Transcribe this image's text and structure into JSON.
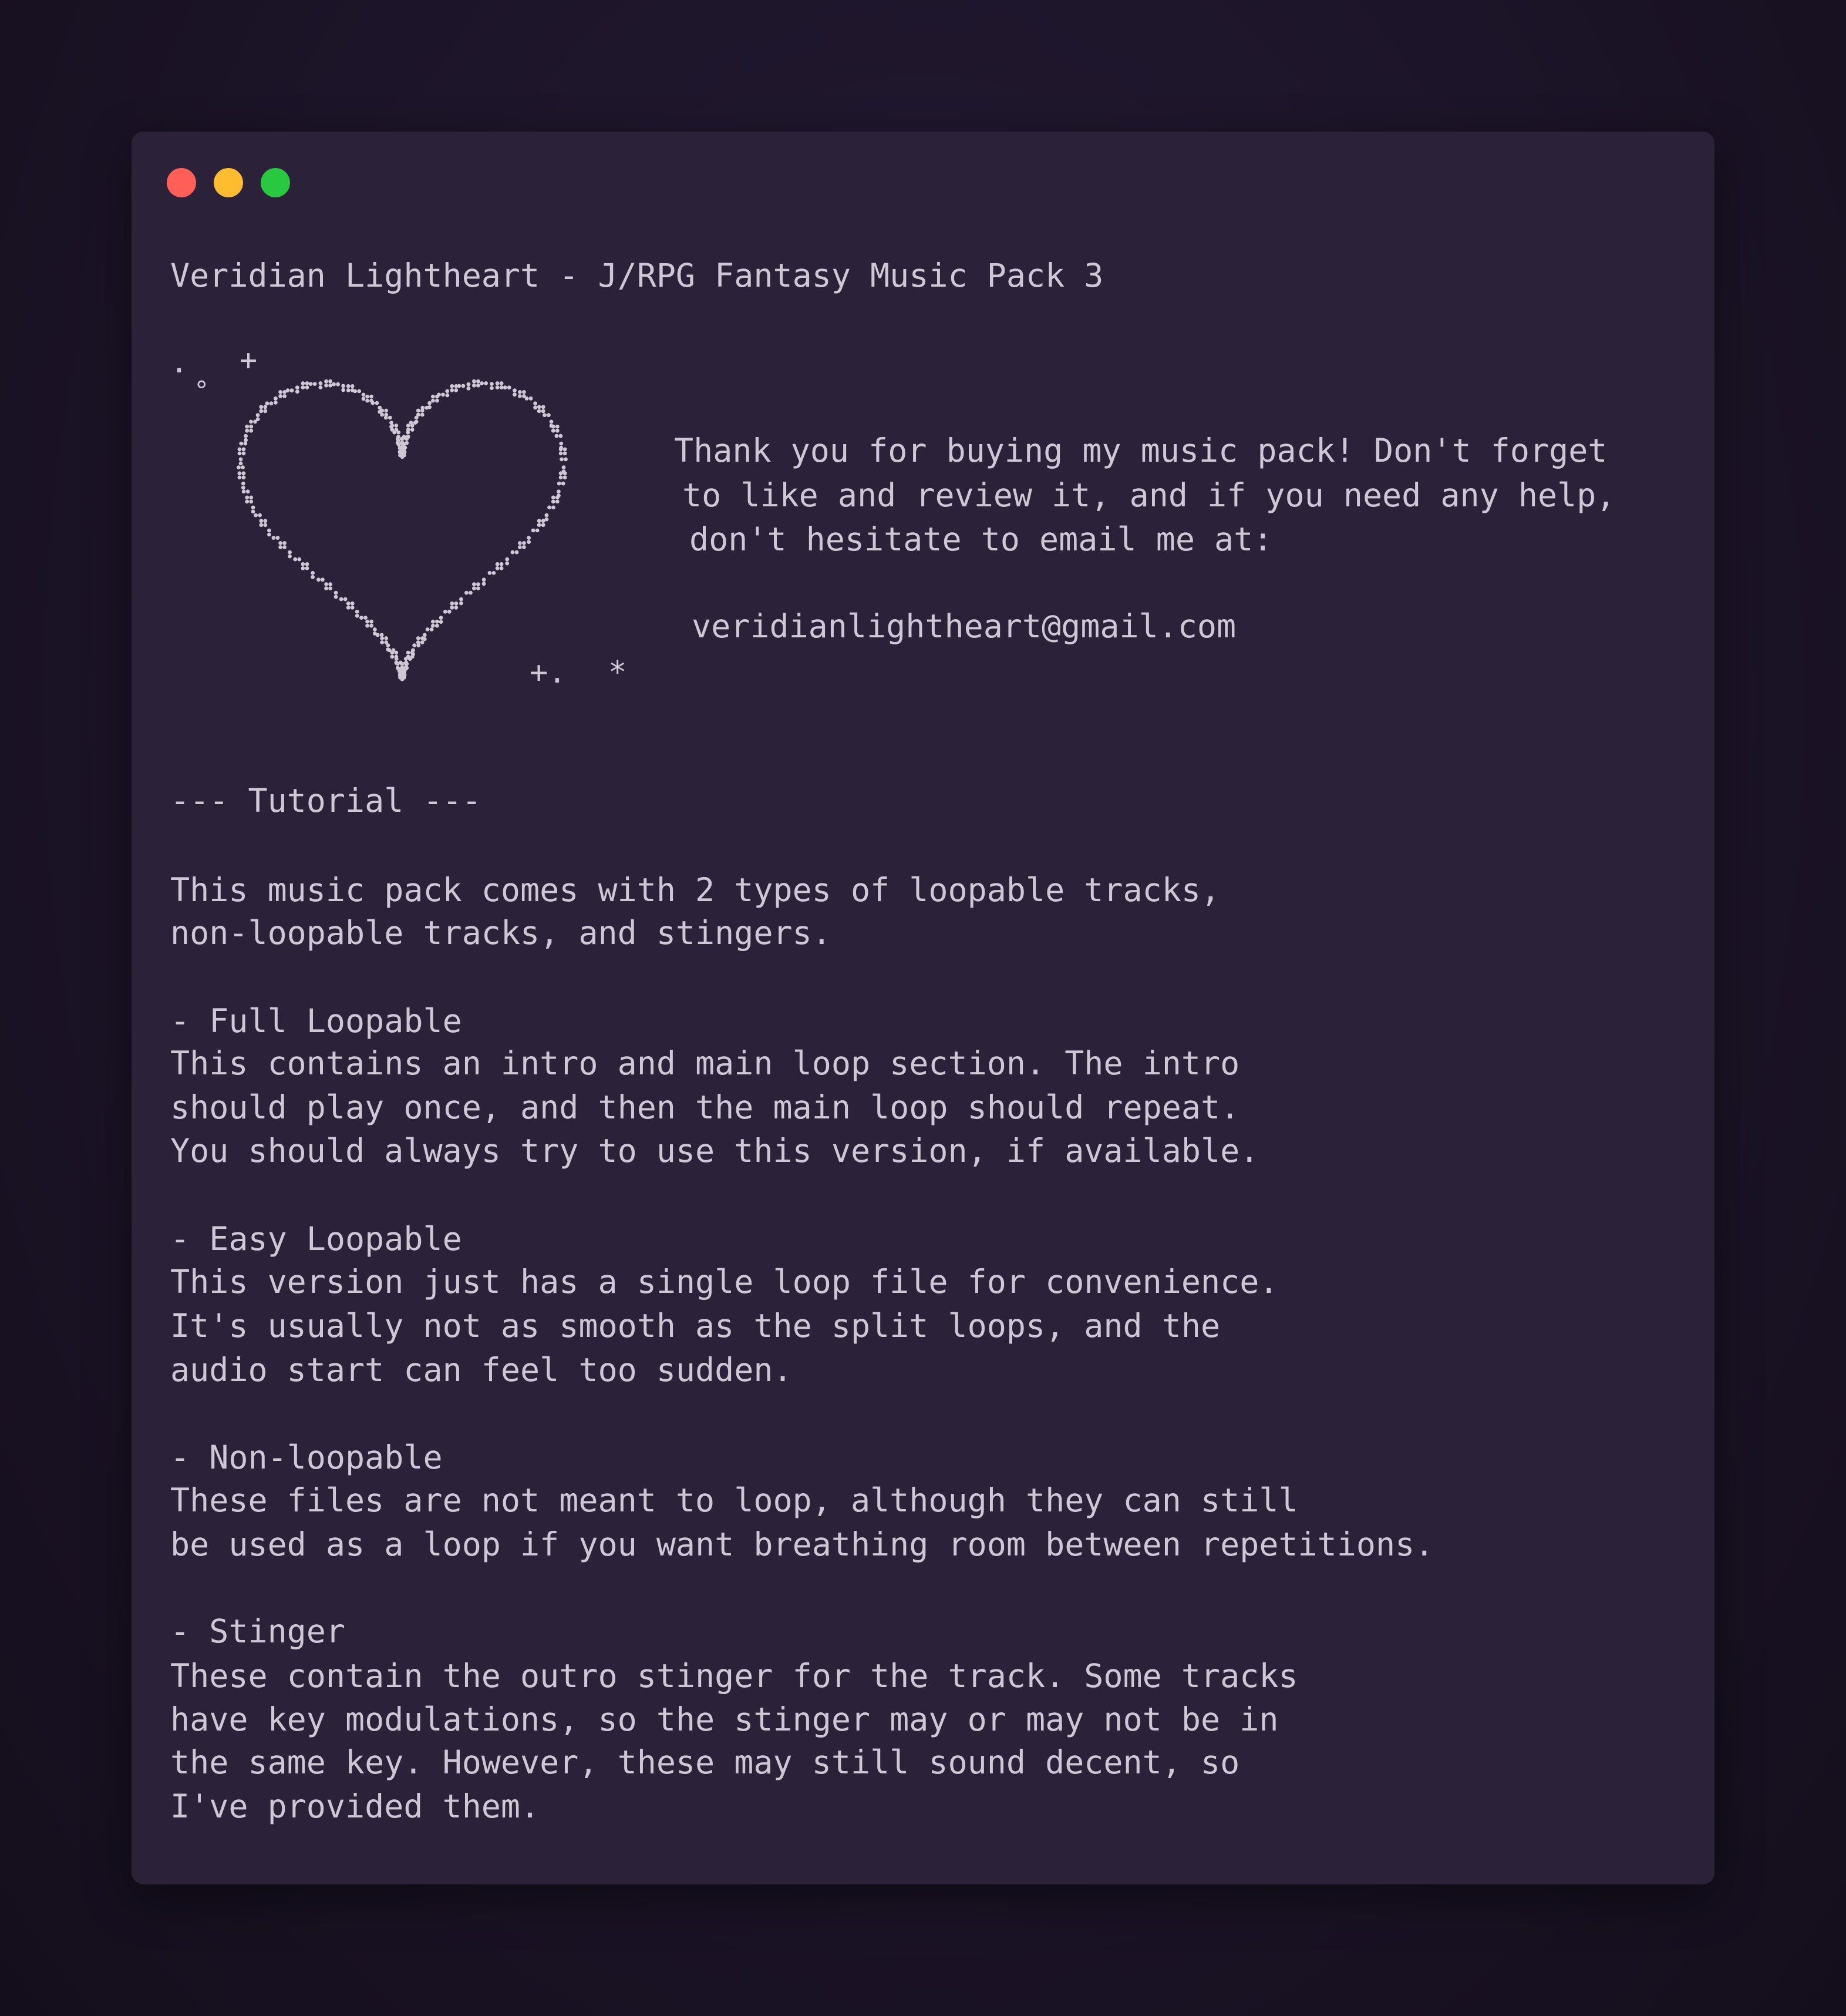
{
  "window": {
    "title": "Veridian Lightheart - J/RPG Fantasy Music Pack 3",
    "controls": [
      "close",
      "minimize",
      "maximize"
    ],
    "colors": {
      "close": "#ff5f57",
      "minimize": "#febc2e",
      "maximize": "#28c840",
      "background": "#2b2139",
      "text": "#cfc7d6"
    }
  },
  "art": {
    "icon": "heart-ascii-art",
    "sparkle_dot": ".",
    "sparkle_plus": "+",
    "sparkle_ring": "°",
    "sparkle_bottom": "+.",
    "sparkle_star": "*"
  },
  "message": {
    "line1": "Thank you for buying my music pack! Don't forget",
    "line2": "to like and review it, and if you need any help,",
    "line3": "don't hesitate to email me at:",
    "email": "veridianlightheart@gmail.com"
  },
  "tutorial": {
    "heading": "--- Tutorial ---",
    "intro": [
      "This music pack comes with 2 types of loopable tracks,",
      "non-loopable tracks, and stingers."
    ],
    "sections": [
      {
        "title": "- Full Loopable",
        "lines": [
          "This contains an intro and main loop section. The intro",
          "should play once, and then the main loop should repeat.",
          "You should always try to use this version, if available."
        ]
      },
      {
        "title": "- Easy Loopable",
        "lines": [
          "This version just has a single loop file for convenience.",
          "It's usually not as smooth as the split loops, and the",
          "audio start can feel too sudden."
        ]
      },
      {
        "title": "- Non-loopable",
        "lines": [
          "These files are not meant to loop, although they can still",
          "be used as a loop if you want breathing room between repetitions."
        ]
      },
      {
        "title": "- Stinger",
        "lines": [
          "These contain the outro stinger for the track. Some tracks",
          "have key modulations, so the stinger may or may not be in",
          "the same key. However, these may still sound decent, so",
          "I've provided them."
        ]
      }
    ]
  }
}
